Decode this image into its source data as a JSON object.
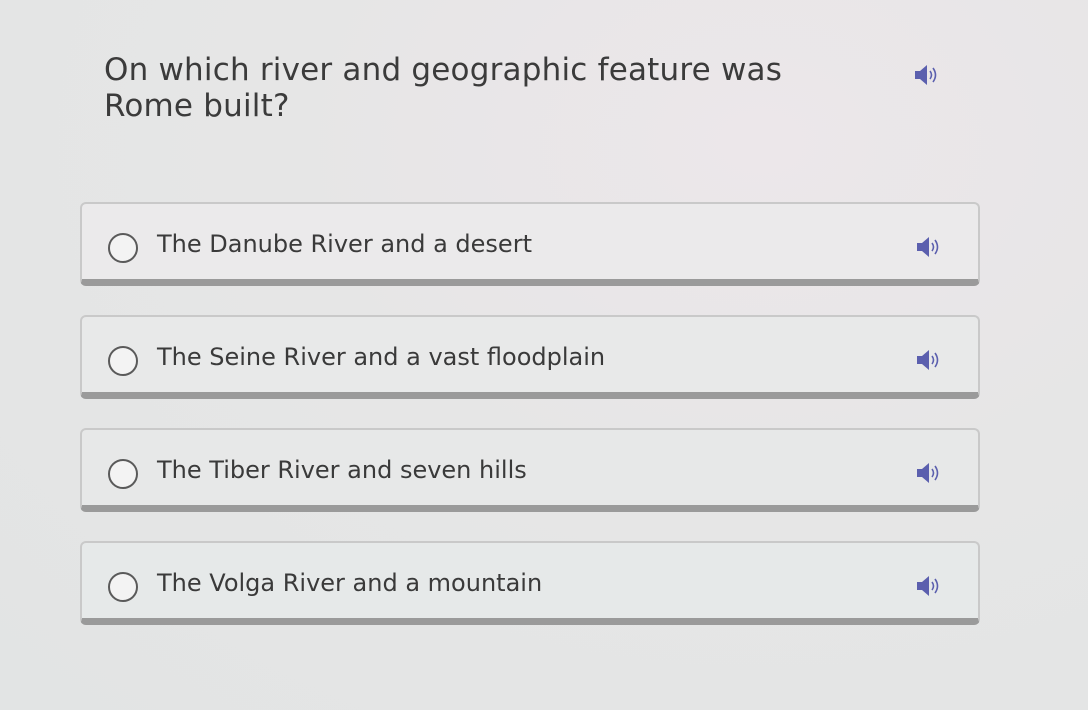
{
  "question": {
    "text": "On which river and geographic feature was Rome built?",
    "speaker_icon": "speaker-icon"
  },
  "options": [
    {
      "label": "The Danube River and a desert",
      "selected": false,
      "speaker_icon": "speaker-icon"
    },
    {
      "label": "The Seine River and a vast floodplain",
      "selected": false,
      "speaker_icon": "speaker-icon"
    },
    {
      "label": "The Tiber River and seven hills",
      "selected": false,
      "speaker_icon": "speaker-icon"
    },
    {
      "label": "The Volga River and a mountain",
      "selected": false,
      "speaker_icon": "speaker-icon"
    }
  ],
  "colors": {
    "speaker_icon": "#5b5fae",
    "option_border_bottom": "#9a9a9a",
    "text": "#3a3a3a"
  }
}
